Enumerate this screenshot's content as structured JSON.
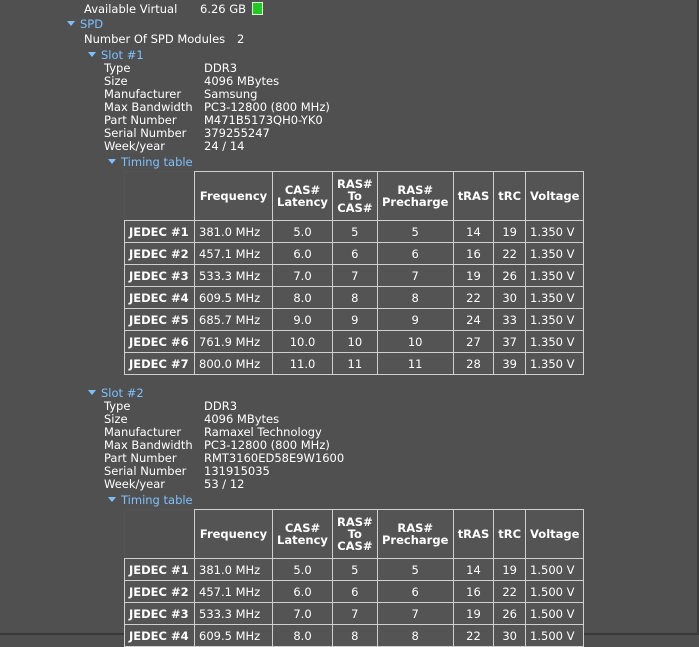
{
  "top": {
    "label": "Available Virtual",
    "value": "6.26 GB"
  },
  "spd": {
    "label": "SPD",
    "modules_label": "Number Of SPD Modules",
    "modules_value": "2",
    "timing_label": "Timing table",
    "headers": [
      "Frequency",
      "CAS# Latency",
      "RAS# To CAS#",
      "RAS# Precharge",
      "tRAS",
      "tRC",
      "Voltage"
    ],
    "slots": [
      {
        "label": "Slot #1",
        "fields": [
          {
            "k": "Type",
            "v": "DDR3"
          },
          {
            "k": "Size",
            "v": "4096 MBytes"
          },
          {
            "k": "Manufacturer",
            "v": "Samsung"
          },
          {
            "k": "Max Bandwidth",
            "v": "PC3-12800 (800 MHz)"
          },
          {
            "k": "Part Number",
            "v": "M471B5173QH0-YK0"
          },
          {
            "k": "Serial Number",
            "v": "379255247"
          },
          {
            "k": "Week/year",
            "v": "24 / 14"
          }
        ],
        "rows": [
          [
            "JEDEC #1",
            "381.0 MHz",
            "5.0",
            "5",
            "5",
            "14",
            "19",
            "1.350 V"
          ],
          [
            "JEDEC #2",
            "457.1 MHz",
            "6.0",
            "6",
            "6",
            "16",
            "22",
            "1.350 V"
          ],
          [
            "JEDEC #3",
            "533.3 MHz",
            "7.0",
            "7",
            "7",
            "19",
            "26",
            "1.350 V"
          ],
          [
            "JEDEC #4",
            "609.5 MHz",
            "8.0",
            "8",
            "8",
            "22",
            "30",
            "1.350 V"
          ],
          [
            "JEDEC #5",
            "685.7 MHz",
            "9.0",
            "9",
            "9",
            "24",
            "33",
            "1.350 V"
          ],
          [
            "JEDEC #6",
            "761.9 MHz",
            "10.0",
            "10",
            "10",
            "27",
            "37",
            "1.350 V"
          ],
          [
            "JEDEC #7",
            "800.0 MHz",
            "11.0",
            "11",
            "11",
            "28",
            "39",
            "1.350 V"
          ]
        ]
      },
      {
        "label": "Slot #2",
        "fields": [
          {
            "k": "Type",
            "v": "DDR3"
          },
          {
            "k": "Size",
            "v": "4096 MBytes"
          },
          {
            "k": "Manufacturer",
            "v": "Ramaxel Technology"
          },
          {
            "k": "Max Bandwidth",
            "v": "PC3-12800 (800 MHz)"
          },
          {
            "k": "Part Number",
            "v": "RMT3160ED58E9W1600"
          },
          {
            "k": "Serial Number",
            "v": "131915035"
          },
          {
            "k": "Week/year",
            "v": "53 / 12"
          }
        ],
        "rows": [
          [
            "JEDEC #1",
            "381.0 MHz",
            "5.0",
            "5",
            "5",
            "14",
            "19",
            "1.500 V"
          ],
          [
            "JEDEC #2",
            "457.1 MHz",
            "6.0",
            "6",
            "6",
            "16",
            "22",
            "1.500 V"
          ],
          [
            "JEDEC #3",
            "533.3 MHz",
            "7.0",
            "7",
            "7",
            "19",
            "26",
            "1.500 V"
          ],
          [
            "JEDEC #4",
            "609.5 MHz",
            "8.0",
            "8",
            "8",
            "22",
            "30",
            "1.500 V"
          ]
        ]
      }
    ]
  }
}
